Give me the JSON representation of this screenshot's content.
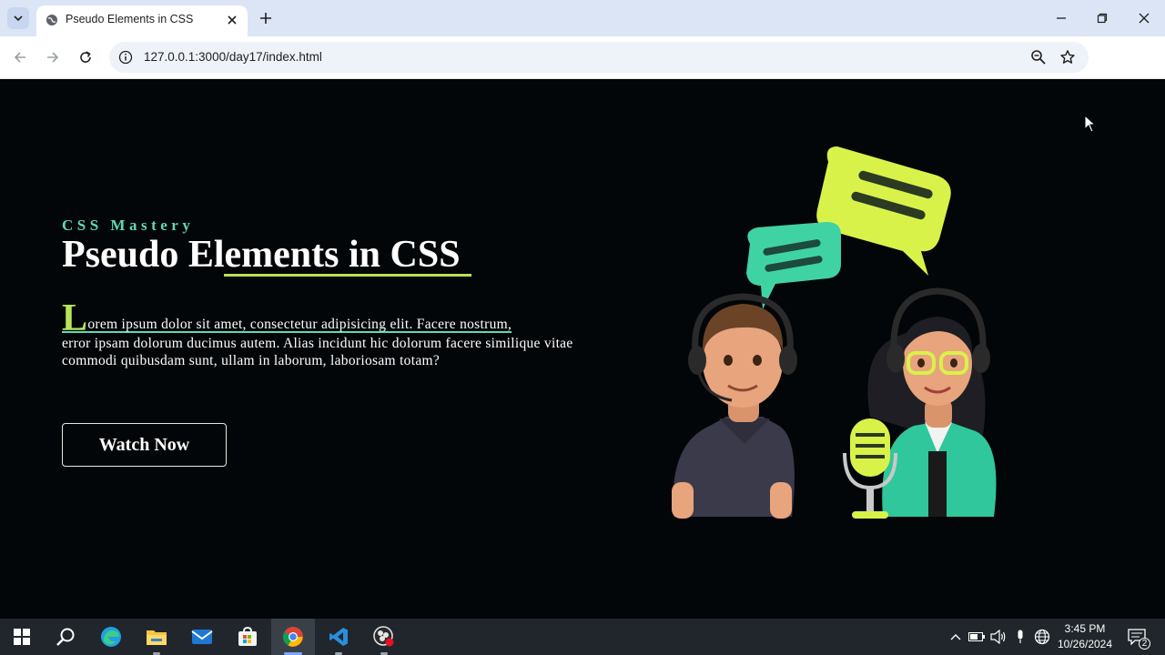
{
  "browser": {
    "tab_title": "Pseudo Elements in CSS",
    "url": "127.0.0.1:3000/day17/index.html"
  },
  "page": {
    "eyebrow": "CSS Mastery",
    "heading": "Pseudo Elements in CSS",
    "paragraph_dropcap": "L",
    "paragraph_first_line": "orem ipsum dolor sit amet, consectetur adipisicing elit. Facere nostrum,",
    "paragraph_rest": "error ipsam dolorum ducimus autem. Alias incidunt hic dolorum facere similique vitae commodi quibusdam sunt, ullam in laborum, laboriosam totam?",
    "cta_label": "Watch Now",
    "colors": {
      "background": "#030608",
      "accent_green": "#b8e35a",
      "accent_teal": "#5fd9b6",
      "bubble_yellow": "#d9f24a",
      "bubble_teal": "#3fd3a3"
    }
  },
  "taskbar": {
    "apps": [
      "windows-start",
      "search",
      "edge",
      "file-explorer",
      "mail",
      "microsoft-store",
      "chrome",
      "vscode",
      "obs-studio"
    ],
    "time": "3:45 PM",
    "date": "10/26/2024",
    "notifications_count": "2"
  }
}
